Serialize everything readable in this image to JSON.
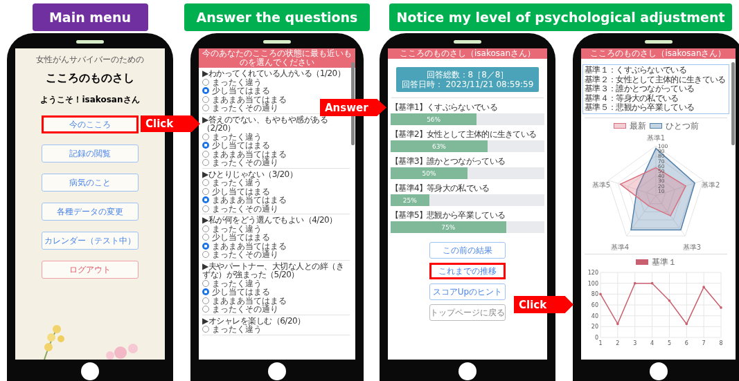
{
  "banners": [
    {
      "text": "Main menu",
      "color": "#7030a0"
    },
    {
      "text": "Answer the questions",
      "color": "#00b050"
    },
    {
      "text": "Notice my level of psychological adjustment",
      "color": "#00b050"
    }
  ],
  "menu_screen": {
    "subtitle": "女性がんサバイバーのための",
    "title": "こころのものさし",
    "welcome": "ようこそ！isakosanさん",
    "buttons": [
      {
        "label": "今のこころ",
        "kind": "normal",
        "highlighted": true
      },
      {
        "label": "記録の閲覧",
        "kind": "normal",
        "highlighted": false
      },
      {
        "label": "病気のこと",
        "kind": "normal",
        "highlighted": false
      },
      {
        "label": "各種データの変更",
        "kind": "normal",
        "highlighted": false
      },
      {
        "label": "カレンダー（テスト中）",
        "kind": "normal",
        "highlighted": false
      },
      {
        "label": "ログアウト",
        "kind": "logout",
        "highlighted": false
      }
    ]
  },
  "question_screen": {
    "header": "今のあなたのこころの状態に最も近いものを選んでください",
    "questions": [
      {
        "text": "▶わかってくれている人がいる（1/20）",
        "options": [
          {
            "label": "まったく違う",
            "selected": false
          },
          {
            "label": "少し当てはまる",
            "selected": true
          },
          {
            "label": "まあまあ当てはまる",
            "selected": false
          },
          {
            "label": "まったくその通り",
            "selected": false
          }
        ]
      },
      {
        "text": "▶答えのでない、もやもや感がある（2/20）",
        "options": [
          {
            "label": "まったく違う",
            "selected": false
          },
          {
            "label": "少し当てはまる",
            "selected": true
          },
          {
            "label": "まあまあ当てはまる",
            "selected": false
          },
          {
            "label": "まったくその通り",
            "selected": false
          }
        ]
      },
      {
        "text": "▶ひとりじゃない（3/20）",
        "options": [
          {
            "label": "まったく違う",
            "selected": false
          },
          {
            "label": "少し当てはまる",
            "selected": false
          },
          {
            "label": "まあまあ当てはまる",
            "selected": true
          },
          {
            "label": "まったくその通り",
            "selected": false
          }
        ]
      },
      {
        "text": "▶私が何をどう選んでもよい（4/20）",
        "options": [
          {
            "label": "まったく違う",
            "selected": false
          },
          {
            "label": "少し当てはまる",
            "selected": false
          },
          {
            "label": "まあまあ当てはまる",
            "selected": true
          },
          {
            "label": "まったくその通り",
            "selected": false
          }
        ]
      },
      {
        "text": "▶夫やパートナー、大切な人との絆（きずな）が強まった（5/20）",
        "options": [
          {
            "label": "まったく違う",
            "selected": false
          },
          {
            "label": "少し当てはまる",
            "selected": true
          },
          {
            "label": "まあまあ当てはまる",
            "selected": false
          },
          {
            "label": "まったくその通り",
            "selected": false
          }
        ]
      },
      {
        "text": "▶オシャレを楽しむ（6/20）",
        "options": [
          {
            "label": "まったく違う",
            "selected": false
          }
        ]
      }
    ]
  },
  "result_screen": {
    "header": "こころのものさし（isakosanさん）",
    "summary": {
      "count": "回答総数：8［8／8］",
      "date": "回答日時： 2023/11/21 08:59:59"
    },
    "criteria": [
      {
        "label": "【基準1】くすぶらないでいる",
        "level": 0.56,
        "reading": "56%"
      },
      {
        "label": "【基準2】女性として主体的に生きている",
        "level": 0.63,
        "reading": "63%"
      },
      {
        "label": "【基準3】誰かとつながっている",
        "level": 0.5,
        "reading": "50%"
      },
      {
        "label": "【基準4】等身大の私でいる",
        "level": 0.25,
        "reading": "25%"
      },
      {
        "label": "【基準5】悲観から卒業している",
        "level": 0.75,
        "reading": "75%"
      }
    ],
    "buttons": [
      {
        "label": "この前の結果",
        "kind": "normal",
        "highlighted": false
      },
      {
        "label": "これまでの推移",
        "kind": "normal",
        "highlighted": true
      },
      {
        "label": "スコアUpのヒント",
        "kind": "normal",
        "highlighted": false
      },
      {
        "label": "トップページに戻る",
        "kind": "plain",
        "highlighted": false
      }
    ]
  },
  "trend_screen": {
    "header": "こころのものさし（isakosanさん）",
    "criteria_list": [
      "基準１：くすぶらないでいる",
      "基準２：女性として主体的に生きている",
      "基準３：誰かとつながっている",
      "基準４：等身大の私でいる",
      "基準５：悲観から卒業している"
    ],
    "radar": {
      "legend": [
        {
          "name": "最新",
          "color": "#d9707f"
        },
        {
          "name": "ひとつ前",
          "color": "#4f7fab"
        }
      ],
      "axis_labels": [
        "基準1",
        "基準2",
        "基準3",
        "基準4",
        "基準5"
      ],
      "ticks": [
        "100",
        "90",
        "80",
        "70",
        "60",
        "50",
        "40",
        "30",
        "20",
        "10"
      ]
    },
    "chart_data": {
      "type": "line",
      "grid": true,
      "categories": [
        "1",
        "2",
        "3",
        "4",
        "5",
        "6",
        "7",
        "8"
      ],
      "ylim": [
        0,
        120
      ],
      "yticks": [
        0,
        20,
        40,
        60,
        80,
        100,
        120
      ],
      "series": [
        {
          "name": "基準１",
          "color": "#c9606f",
          "values": [
            80,
            25,
            100,
            100,
            68,
            25,
            93,
            55
          ]
        }
      ]
    }
  },
  "arrows": [
    {
      "text": "Click"
    },
    {
      "text": "Answer"
    },
    {
      "text": "Click"
    }
  ]
}
